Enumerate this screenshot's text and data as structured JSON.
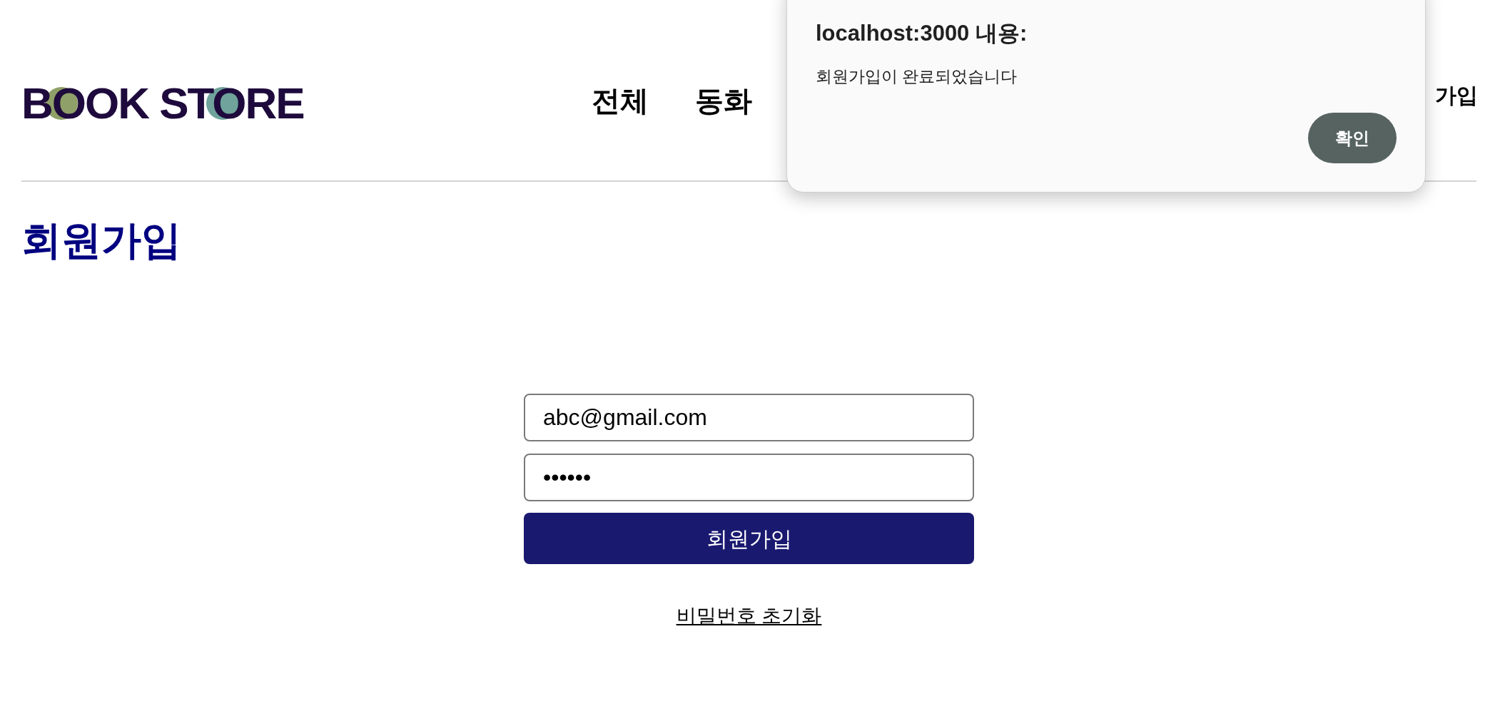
{
  "header": {
    "logo": {
      "text": "BOOK STORE"
    },
    "nav": [
      {
        "label": "전체"
      },
      {
        "label": "동화"
      }
    ],
    "auth_links": [
      {
        "label": "가입"
      }
    ]
  },
  "page_title": "회원가입",
  "form": {
    "fields": [
      {
        "kind": "email",
        "value": "abc@gmail.com"
      },
      {
        "kind": "password",
        "value": "••••••"
      }
    ],
    "submit": {
      "label": "회원가입"
    },
    "link": {
      "label": "비밀번호 초기화"
    }
  },
  "alert_dialog": {
    "title": "localhost:3000 내용:",
    "message": "회원가입이 완료되었습니다",
    "buttons": [
      {
        "label": "확인"
      }
    ]
  }
}
